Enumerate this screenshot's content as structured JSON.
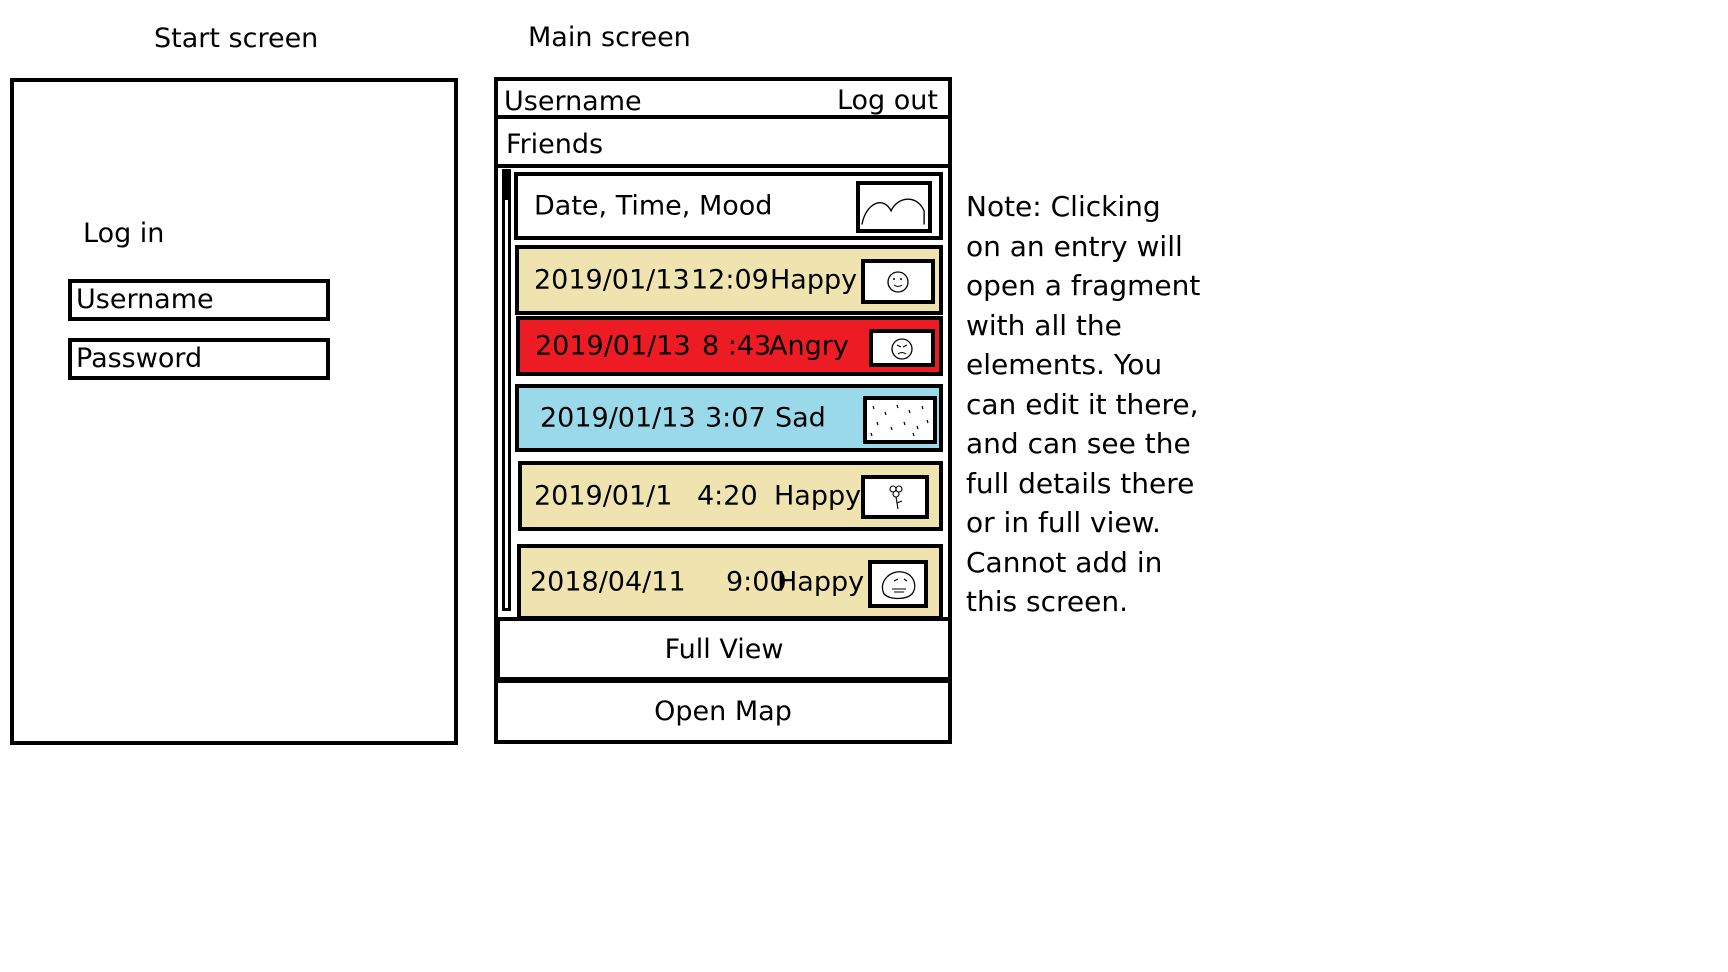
{
  "start_screen": {
    "caption": "Start screen",
    "login_label": "Log in",
    "username_value": "Username",
    "password_value": "Password"
  },
  "main_screen": {
    "caption": "Main screen",
    "header": {
      "username": "Username",
      "logout": "Log out"
    },
    "friends_label": "Friends",
    "list_header": "Date, Time, Mood",
    "entries": [
      {
        "date": "2019/01/13",
        "time": "12:09",
        "mood": "Happy",
        "color": "#efe4b0",
        "icon": "smiley-sketch-icon"
      },
      {
        "date": "2019/01/13",
        "time": "8 :43",
        "mood": "Angry",
        "color": "#ed1c24",
        "icon": "angry-face-sketch-icon"
      },
      {
        "date": "2019/01/13",
        "time": "3:07",
        "mood": "Sad",
        "color": "#99d9ea",
        "icon": "rain-sketch-icon"
      },
      {
        "date": "2019/01/1",
        "time": "4:20",
        "mood": "Happy",
        "color": "#efe4b0",
        "icon": "flower-sketch-icon"
      },
      {
        "date": "2018/04/11",
        "time": "9:00",
        "mood": "Happy",
        "color": "#efe4b0",
        "icon": "face-sketch-icon"
      }
    ],
    "full_view_label": "Full View",
    "open_map_label": "Open Map"
  },
  "note": {
    "lines": [
      "Note: Clicking",
      "on an entry will",
      "open a fragment",
      "with all the",
      "elements. You",
      "can edit it there,",
      "and can see the",
      "full details there",
      "or in full view.",
      "Cannot add in",
      "this screen."
    ]
  }
}
